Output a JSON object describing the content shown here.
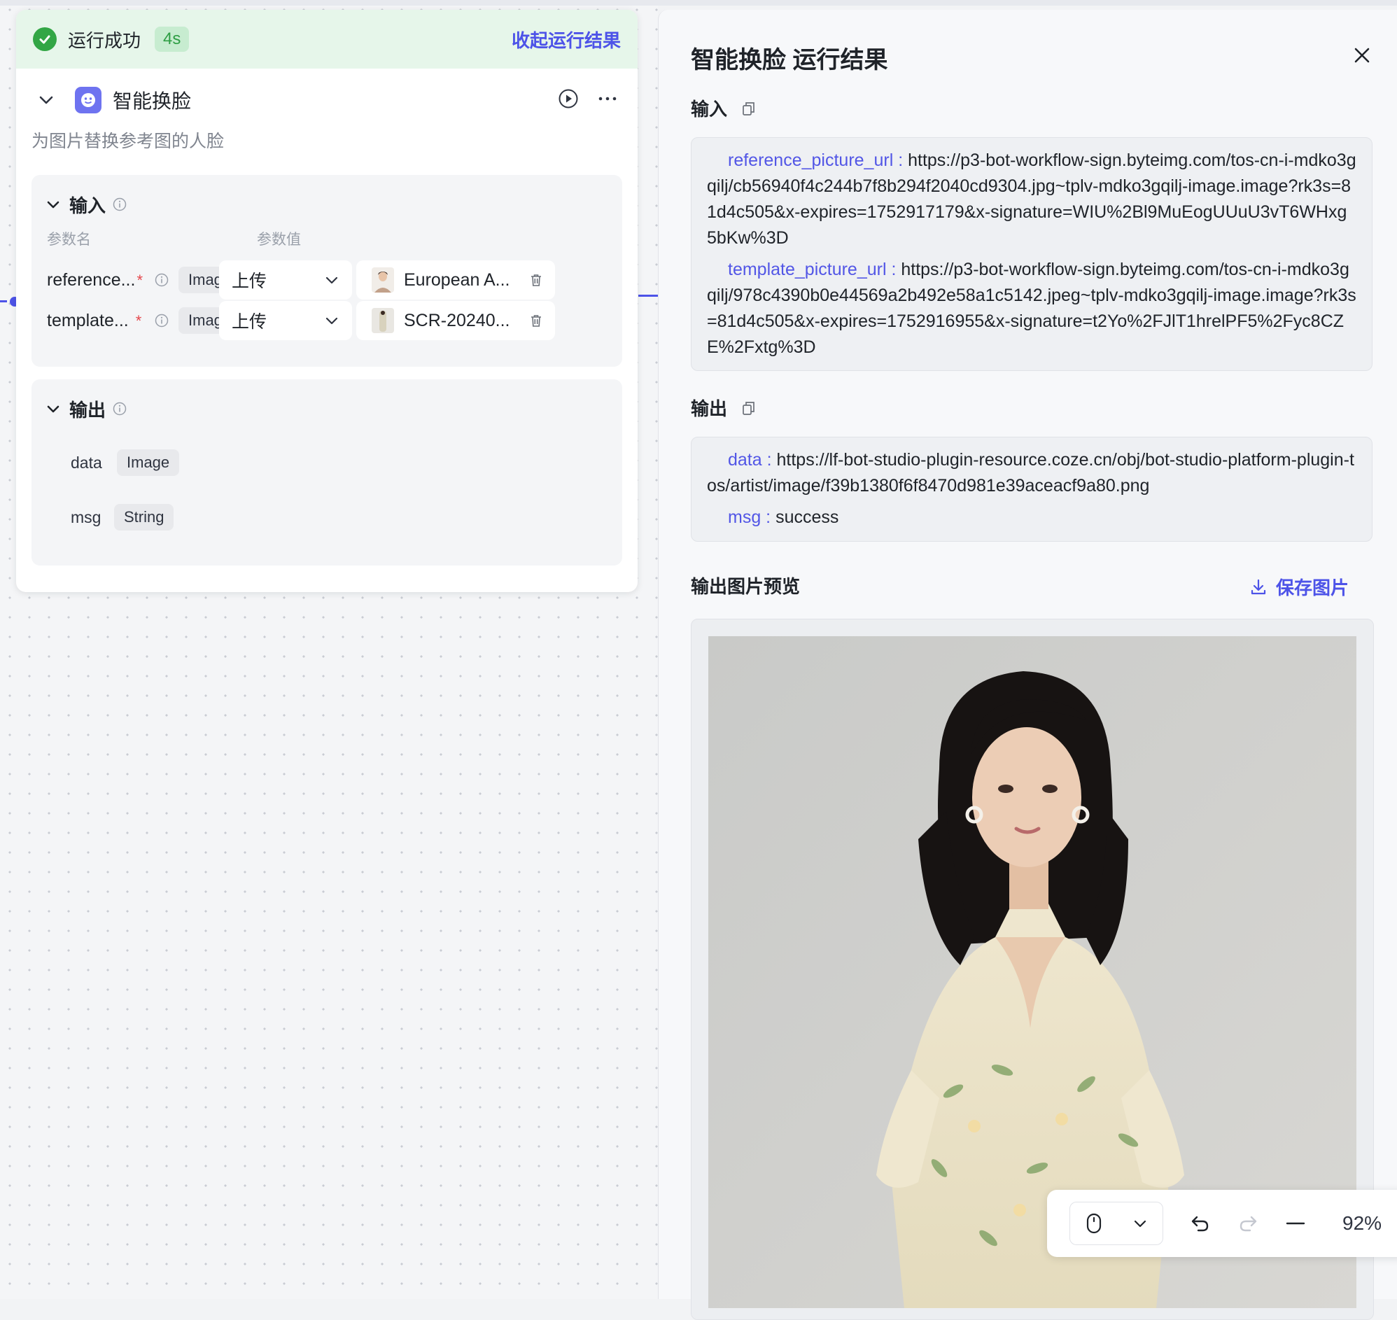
{
  "node": {
    "run_status": "运行成功",
    "run_time": "4s",
    "collapse_label": "收起运行结果",
    "title": "智能换脸",
    "description": "为图片替换参考图的人脸",
    "input_section": {
      "title": "输入",
      "col_name": "参数名",
      "col_value": "参数值",
      "params": [
        {
          "name": "reference...",
          "required_mark": "*",
          "type": "Image",
          "mode": "上传",
          "file": "European A..."
        },
        {
          "name": "template...",
          "required_mark": "*",
          "type": "Image",
          "mode": "上传",
          "file": "SCR-20240..."
        }
      ]
    },
    "output_section": {
      "title": "输出",
      "params": [
        {
          "name": "data",
          "type": "Image"
        },
        {
          "name": "msg",
          "type": "String"
        }
      ]
    }
  },
  "panel": {
    "title": "智能换脸 运行结果",
    "input_label": "输入",
    "input": [
      {
        "key": "reference_picture_url :",
        "value": "https://p3-bot-workflow-sign.byteimg.com/tos-cn-i-mdko3gqilj/cb56940f4c244b7f8b294f2040cd9304.jpg~tplv-mdko3gqilj-image.image?rk3s=81d4c505&x-expires=1752917179&x-signature=WIU%2Bl9MuEogUUuU3vT6WHxg5bKw%3D"
      },
      {
        "key": "template_picture_url :",
        "value": "https://p3-bot-workflow-sign.byteimg.com/tos-cn-i-mdko3gqilj/978c4390b0e44569a2b492e58a1c5142.jpeg~tplv-mdko3gqilj-image.image?rk3s=81d4c505&x-expires=1752916955&x-signature=t2Yo%2FJlT1hrelPF5%2Fyc8CZE%2Fxtg%3D"
      }
    ],
    "output_label": "输出",
    "output": [
      {
        "key": "data :",
        "value": "https://lf-bot-studio-plugin-resource.coze.cn/obj/bot-studio-platform-plugin-tos/artist/image/f39b1380f6f8470d981e39aceacf9a80.png"
      },
      {
        "key": "msg :",
        "value": "success"
      }
    ],
    "preview_label": "输出图片预览",
    "save_label": "保存图片"
  },
  "toolbar": {
    "zoom": "92%"
  },
  "colors": {
    "accent": "#4d53e8",
    "success": "#32a645",
    "success_bg": "#e6f6ea"
  }
}
